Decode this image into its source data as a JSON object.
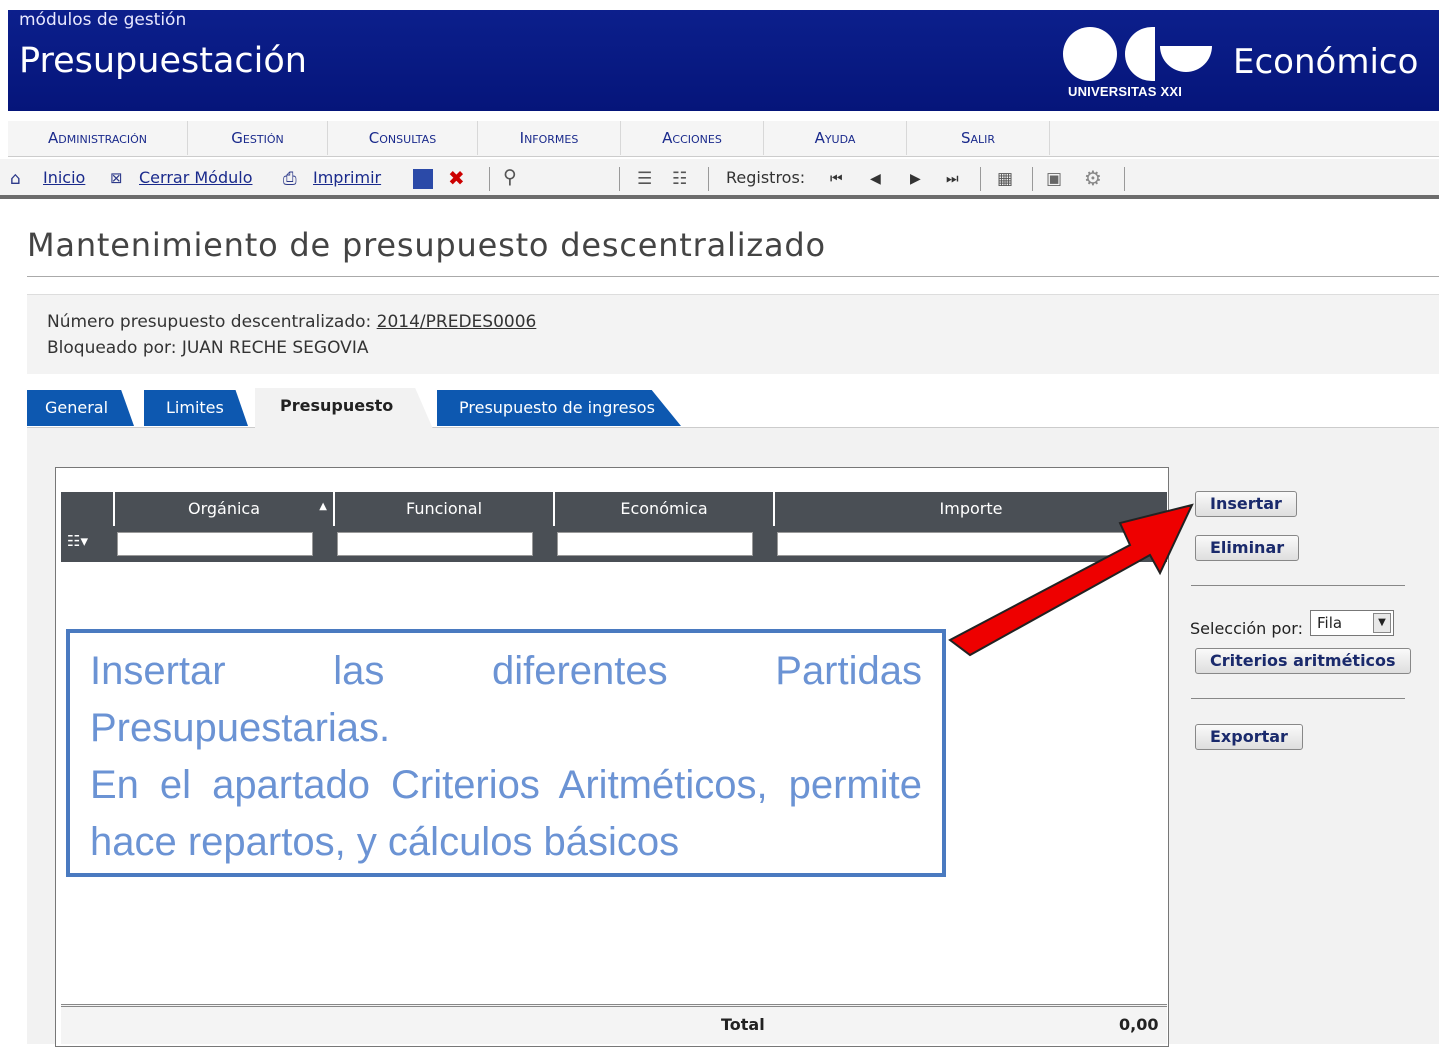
{
  "header": {
    "module": "módulos de gestión",
    "title": "Presupuestación",
    "logo_sub": "UNIVERSITAS XXI",
    "logo_name": "Económico",
    "colors": {
      "bar": "#0c1f8c"
    }
  },
  "menu": [
    "Administración",
    "Gestión",
    "Consultas",
    "Informes",
    "Acciones",
    "Ayuda",
    "Salir"
  ],
  "toolbar": {
    "inicio": "Inicio",
    "cerrar": "Cerrar Módulo",
    "imprimir": "Imprimir",
    "registros": "Registros:",
    "icons": [
      "home-icon",
      "close-box-icon",
      "print-icon",
      "save-icon",
      "delete-save-icon",
      "search-icon",
      "record-add-icon",
      "record-edit-icon",
      "first-icon",
      "prev-icon",
      "next-icon",
      "last-icon",
      "grid-icon",
      "folder-icon",
      "settings-icon"
    ]
  },
  "page": {
    "title": "Mantenimiento de presupuesto descentralizado"
  },
  "info": {
    "numero_label": "Número presupuesto descentralizado:",
    "numero_value": "2014/PREDES0006",
    "bloqueado": "Bloqueado por: JUAN RECHE SEGOVIA"
  },
  "tabs": [
    "General",
    "Limites",
    "Presupuesto",
    "Presupuesto de ingresos"
  ],
  "active_tab": "Presupuesto",
  "grid": {
    "columns": [
      "Orgánica",
      "Funcional",
      "Económica",
      "Importe"
    ],
    "footer_label": "Total",
    "footer_value": "0,00"
  },
  "side": {
    "insertar": "Insertar",
    "eliminar": "Eliminar",
    "seleccion_label": "Selección por:",
    "seleccion_value": "Fila",
    "criterios": "Criterios aritméticos",
    "exportar": "Exportar"
  },
  "callout": {
    "line1": "Insertar las diferentes Partidas Presupuestarias.",
    "line2": "En el apartado Criterios Aritméticos, permite hace repartos, y cálculos básicos"
  },
  "colors": {
    "accent": "#0d58b0",
    "arrow": "#ee0000",
    "callout": "#6b93d4"
  }
}
